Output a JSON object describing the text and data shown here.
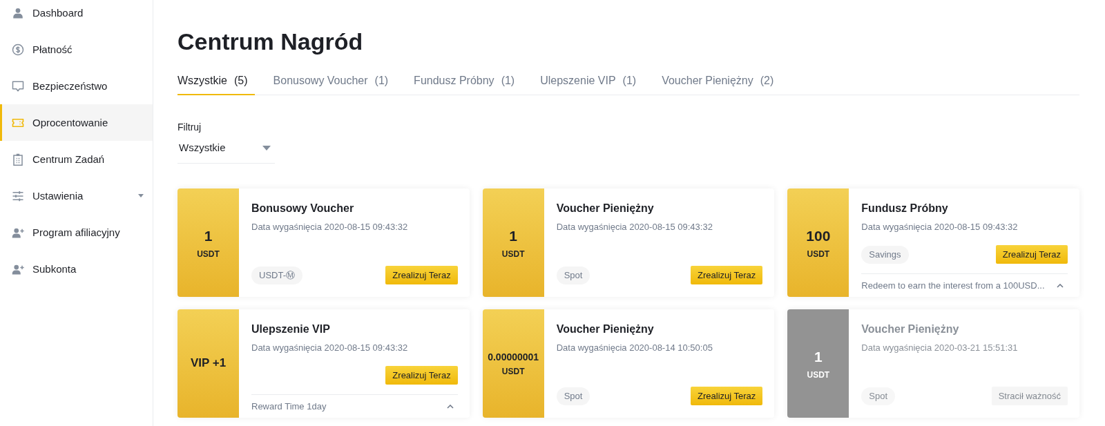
{
  "sidebar": {
    "items": [
      {
        "label": "Dashboard",
        "kind": "link",
        "selected": false
      },
      {
        "label": "Płatność",
        "kind": "link",
        "selected": false
      },
      {
        "label": "Bezpieczeństwo",
        "kind": "link",
        "selected": false
      },
      {
        "label": "Oprocentowanie",
        "kind": "link",
        "selected": true
      },
      {
        "label": "Centrum Zadań",
        "kind": "link",
        "selected": false
      },
      {
        "label": "Ustawienia",
        "kind": "group",
        "selected": false
      },
      {
        "label": "Program afiliacyjny",
        "kind": "link",
        "selected": false
      },
      {
        "label": "Subkonta",
        "kind": "link",
        "selected": false
      }
    ]
  },
  "page_title": "Centrum Nagród",
  "tabs": [
    {
      "label": "Wszystkie",
      "count": "(5)",
      "selected": true
    },
    {
      "label": "Bonusowy Voucher",
      "count": "(1)",
      "selected": false
    },
    {
      "label": "Fundusz Próbny",
      "count": "(1)",
      "selected": false
    },
    {
      "label": "Ulepszenie VIP",
      "count": "(1)",
      "selected": false
    },
    {
      "label": "Voucher Pieniężny",
      "count": "(2)",
      "selected": false
    }
  ],
  "filter": {
    "label": "Filtruj",
    "value": "Wszystkie"
  },
  "cards": [
    {
      "amount": "1",
      "unit": "USDT",
      "title": "Bonusowy Voucher",
      "expiry": "Data wygaśnięcia 2020-08-15 09:43:32",
      "tag": "USDT-Ⓜ",
      "button": "Zrealizuj Teraz",
      "disabled": false
    },
    {
      "amount": "1",
      "unit": "USDT",
      "title": "Voucher Pieniężny",
      "expiry": "Data wygaśnięcia 2020-08-15 09:43:32",
      "tag": "Spot",
      "button": "Zrealizuj Teraz",
      "disabled": false
    },
    {
      "amount": "100",
      "unit": "USDT",
      "title": "Fundusz Próbny",
      "expiry": "Data wygaśnięcia 2020-08-15 09:43:32",
      "tag": "Savings",
      "button": "Zrealizuj Teraz",
      "disabled": false,
      "note": {
        "text": "Redeem to earn the interest from a 100USD...",
        "expanded": true
      }
    },
    {
      "amount": "VIP +1",
      "title": "Ulepszenie VIP",
      "expiry": "Data wygaśnięcia 2020-08-15 09:43:32",
      "button": "Zrealizuj Teraz",
      "disabled": false,
      "note": {
        "text": "Reward Time 1day",
        "expanded": true
      }
    },
    {
      "amount": "0.00000001",
      "unit": "USDT",
      "title": "Voucher Pieniężny",
      "expiry": "Data wygaśnięcia 2020-08-14 10:50:05",
      "tag": "Spot",
      "button": "Zrealizuj Teraz",
      "disabled": false
    },
    {
      "amount": "1",
      "unit": "USDT",
      "title": "Voucher Pieniężny",
      "expiry": "Data wygaśnięcia 2020-03-21 15:51:31",
      "tag": "Spot",
      "button": "Stracił ważność",
      "disabled": true
    }
  ]
}
